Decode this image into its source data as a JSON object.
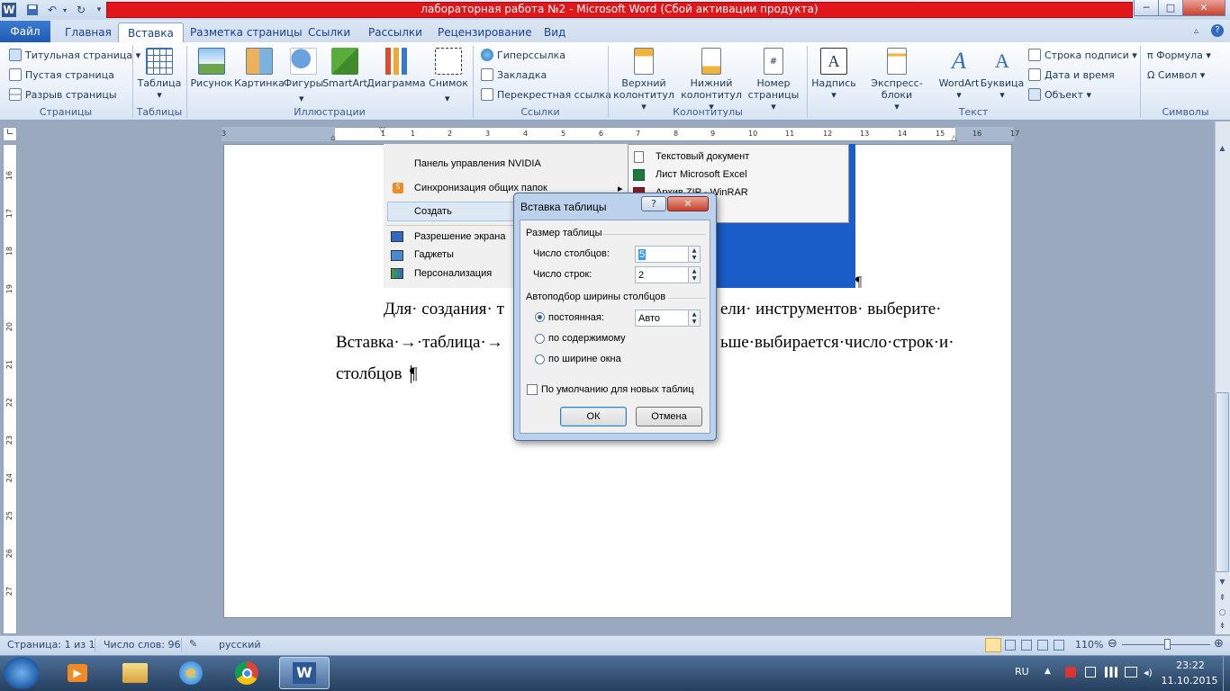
{
  "window": {
    "title": "лабораторная работа №2  -  Microsoft Word (Сбой активации продукта)"
  },
  "qat": {
    "word_icon": "W",
    "save_icon": "save-icon",
    "undo_icon": "↶",
    "redo_icon": "↻"
  },
  "winbuttons": {
    "min": "─",
    "max": "□",
    "close": "✕"
  },
  "tabs": [
    "Файл",
    "Главная",
    "Вставка",
    "Разметка страницы",
    "Ссылки",
    "Рассылки",
    "Рецензирование",
    "Вид"
  ],
  "ribbon": {
    "pages": {
      "items": [
        "Титульная страница ▾",
        "Пустая страница",
        "Разрыв страницы"
      ],
      "label": "Страницы"
    },
    "tables": {
      "button": "Таблица",
      "arrow": "▾",
      "label": "Таблицы"
    },
    "illustrations": {
      "buttons": [
        "Рисунок",
        "Картинка",
        "Фигуры",
        "SmartArt",
        "Диаграмма",
        "Снимок"
      ],
      "arrows": [
        "",
        "",
        "▾",
        "",
        "",
        "▾"
      ],
      "label": "Иллюстрации"
    },
    "links": {
      "items": [
        "Гиперссылка",
        "Закладка",
        "Перекрестная ссылка"
      ],
      "label": "Ссылки"
    },
    "headers": {
      "buttons": [
        {
          "l1": "Верхний",
          "l2": "колонтитул ▾"
        },
        {
          "l1": "Нижний",
          "l2": "колонтитул ▾"
        },
        {
          "l1": "Номер",
          "l2": "страницы ▾"
        }
      ],
      "label": "Колонтитулы"
    },
    "text": {
      "buttons": [
        "Надпись",
        "Экспресс-блоки",
        "WordArt",
        "Буквица"
      ],
      "arrows": [
        "▾",
        "▾",
        "▾",
        "▾"
      ],
      "small": [
        "Строка подписи ▾",
        "Дата и время",
        "Объект ▾"
      ],
      "label": "Текст"
    },
    "symbols": {
      "items": [
        "π Формула ▾",
        "Ω Символ ▾"
      ],
      "label": "Символы"
    }
  },
  "ruler": {
    "h_ticks": [
      "3",
      "1",
      "1",
      "2",
      "3",
      "4",
      "5",
      "6",
      "7",
      "8",
      "9",
      "10",
      "11",
      "12",
      "13",
      "14",
      "15",
      "16",
      "17"
    ],
    "v_ticks": [
      "16",
      "17",
      "18",
      "19",
      "20",
      "21",
      "22",
      "23",
      "24",
      "25",
      "26",
      "27"
    ]
  },
  "embedded": {
    "menu_items": [
      "Панель управления NVIDIA",
      "Синхронизация общих папок",
      "Создать",
      "Разрешение экрана",
      "Гаджеты",
      "Персонализация"
    ],
    "submenu_items": [
      "Текстовый документ",
      "Лист Microsoft Excel",
      "Архив ZIP - WinRAR"
    ],
    "submenu_arrow": "▸"
  },
  "document": {
    "line1_left": "Для· создания· т",
    "line1_right": "ели· инструментов· выберите·",
    "line2_left": "Вставка·→·таблица·→",
    "line2_right": "ьше·выбирается·число·строк·и·",
    "line3": "столбцов",
    "pilcrow": "¶"
  },
  "dialog": {
    "title": "Вставка таблицы",
    "help": "?",
    "close": "✕",
    "size_group": "Размер таблицы",
    "cols_label": "Число столбцов:",
    "cols_value": "5",
    "rows_label": "Число строк:",
    "rows_value": "2",
    "autofit_group": "Автоподбор ширины столбцов",
    "fixed_label": "постоянная:",
    "fixed_value": "Авто",
    "content_label": "по содержимому",
    "window_label": "по ширине окна",
    "default_label": "По умолчанию для новых таблиц",
    "ok": "ОК",
    "cancel": "Отмена",
    "spin_up": "▲",
    "spin_down": "▼"
  },
  "status": {
    "page": "Страница: 1 из 1",
    "words": "Число слов: 96",
    "lang": "русский",
    "zoom": "110%",
    "zoom_minus": "⊖",
    "zoom_plus": "⊕"
  },
  "taskbar": {
    "lang": "RU",
    "time": "23:22",
    "date": "11.10.2015",
    "word_label": "W"
  }
}
